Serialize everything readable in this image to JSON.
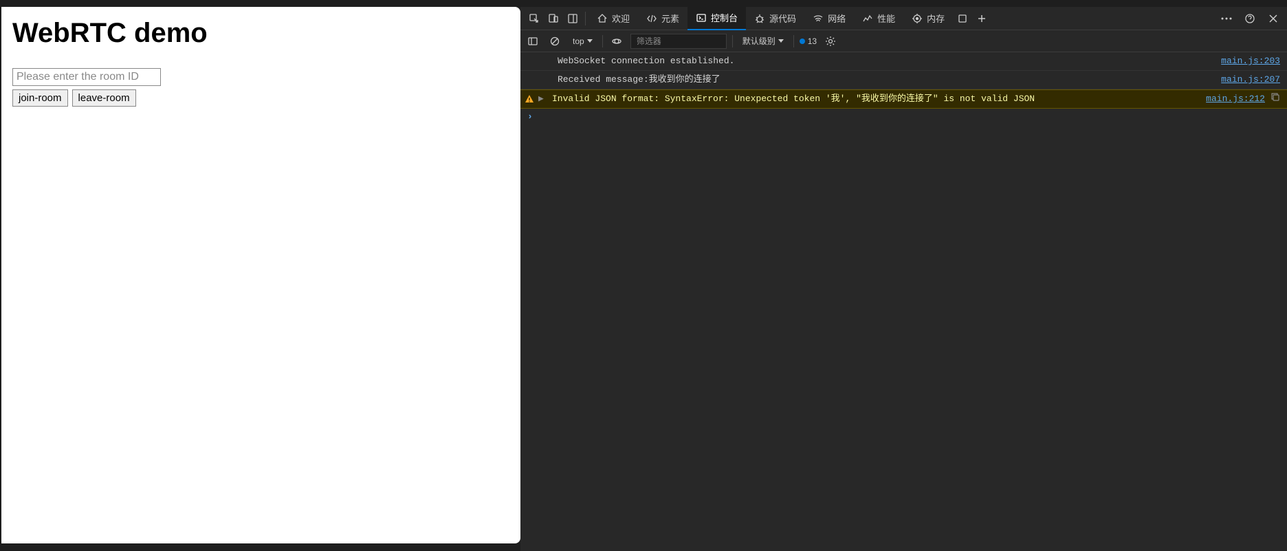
{
  "page": {
    "title": "WebRTC demo",
    "room_placeholder": "Please enter the room ID",
    "join_label": "join-room",
    "leave_label": "leave-room"
  },
  "devtools": {
    "tabs": {
      "welcome": "欢迎",
      "elements": "元素",
      "console": "控制台",
      "sources": "源代码",
      "network": "网络",
      "performance": "性能",
      "memory": "内存"
    },
    "toolbar": {
      "context": "top",
      "filter_placeholder": "筛选器",
      "level_label": "默认级别",
      "issue_count": "13"
    },
    "messages": [
      {
        "type": "log",
        "text": "WebSocket connection established.",
        "source": "main.js:203"
      },
      {
        "type": "log",
        "text": "Received message:我收到你的连接了",
        "source": "main.js:207"
      },
      {
        "type": "warn",
        "text": "Invalid JSON format: SyntaxError: Unexpected token '我', \"我收到你的连接了\" is not valid JSON",
        "source": "main.js:212"
      }
    ]
  }
}
